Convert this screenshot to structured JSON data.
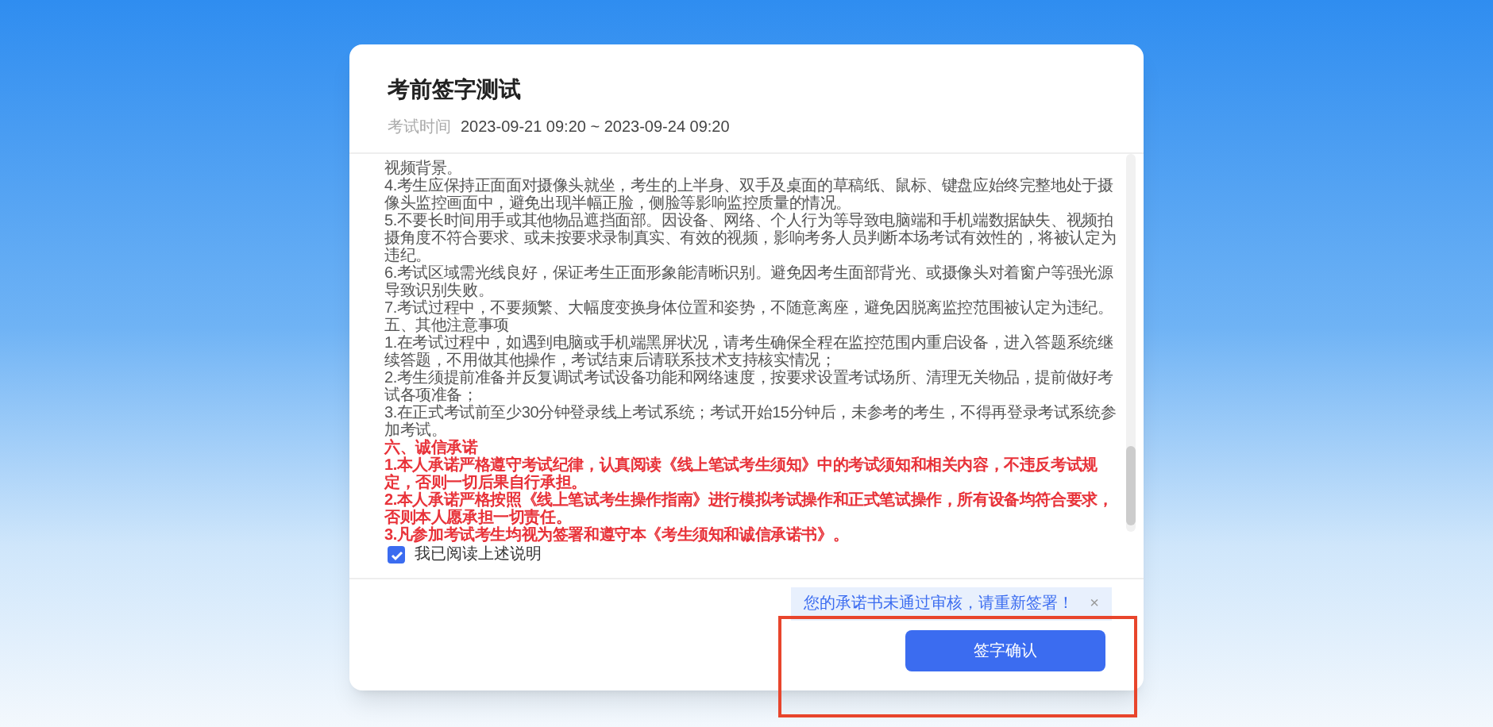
{
  "dialog": {
    "title": "考前签字测试",
    "time_label": "考试时间",
    "time_value": "2023-09-21 09:20 ~ 2023-09-24 09:20"
  },
  "paragraphs": [
    {
      "kind": "normal",
      "text": "视频背景。"
    },
    {
      "kind": "normal",
      "text": "4.考生应保持正面面对摄像头就坐，考生的上半身、双手及桌面的草稿纸、鼠标、键盘应始终完整地处于摄像头监控画面中，避免出现半幅正脸，侧脸等影响监控质量的情况。"
    },
    {
      "kind": "normal",
      "text": "5.不要长时间用手或其他物品遮挡面部。因设备、网络、个人行为等导致电脑端和手机端数据缺失、视频拍摄角度不符合要求、或未按要求录制真实、有效的视频，影响考务人员判断本场考试有效性的，将被认定为违纪。"
    },
    {
      "kind": "normal",
      "text": "6.考试区域需光线良好，保证考生正面形象能清晰识别。避免因考生面部背光、或摄像头对着窗户等强光源导致识别失败。"
    },
    {
      "kind": "normal",
      "text": "7.考试过程中，不要频繁、大幅度变换身体位置和姿势，不随意离座，避免因脱离监控范围被认定为违纪。"
    },
    {
      "kind": "normal",
      "text": "五、其他注意事项"
    },
    {
      "kind": "normal",
      "text": "1.在考试过程中，如遇到电脑或手机端黑屏状况，请考生确保全程在监控范围内重启设备，进入答题系统继续答题，不用做其他操作，考试结束后请联系技术支持核实情况；"
    },
    {
      "kind": "normal",
      "text": "2.考生须提前准备并反复调试考试设备功能和网络速度，按要求设置考试场所、清理无关物品，提前做好考试各项准备；"
    },
    {
      "kind": "normal",
      "text": "3.在正式考试前至少30分钟登录线上考试系统；考试开始15分钟后，未参考的考生，不得再登录考试系统参加考试。"
    },
    {
      "kind": "red",
      "text": "六、诚信承诺"
    },
    {
      "kind": "red",
      "text": "1.本人承诺严格遵守考试纪律，认真阅读《线上笔试考生须知》中的考试须知和相关内容，不违反考试规定，否则一切后果自行承担。"
    },
    {
      "kind": "red",
      "text": "2.本人承诺严格按照《线上笔试考生操作指南》进行模拟考试操作和正式笔试操作，所有设备均符合要求，否则本人愿承担一切责任。"
    },
    {
      "kind": "red",
      "text": "3.凡参加考试考生均视为签署和遵守本《考生须知和诚信承诺书》。"
    }
  ],
  "agree": {
    "label": "我已阅读上述说明",
    "checked": true
  },
  "toast": {
    "message": "您的承诺书未通过审核，请重新签署！",
    "close": "×"
  },
  "confirm_button": "签字确认"
}
